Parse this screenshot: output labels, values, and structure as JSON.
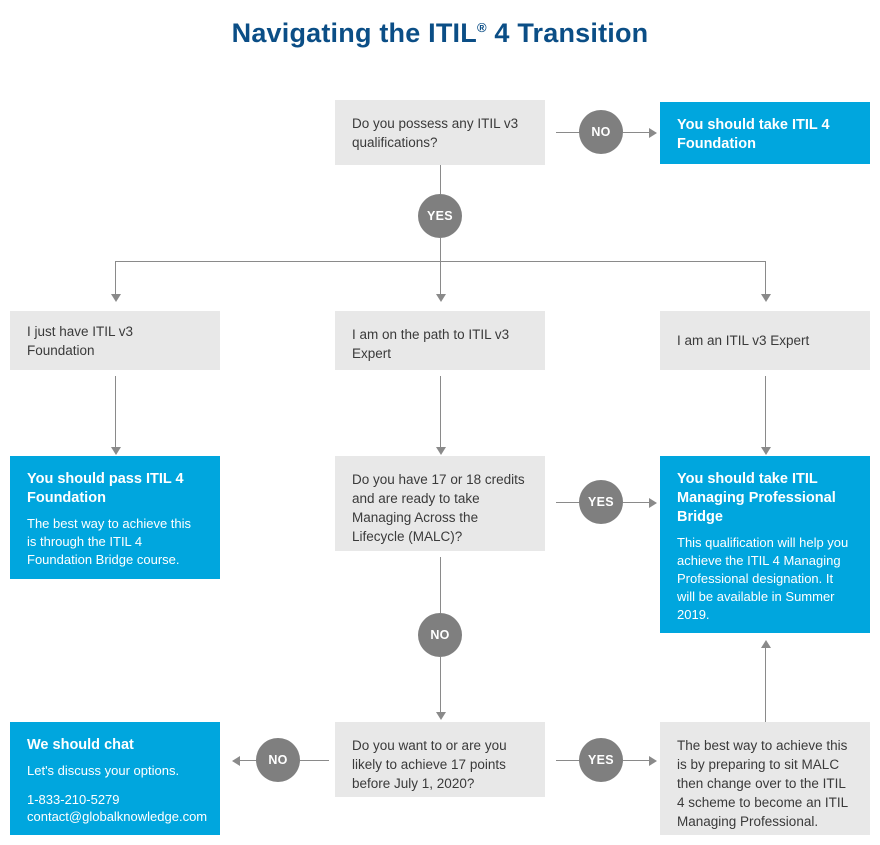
{
  "title": {
    "text_before": "Navigating the ITIL",
    "registered_mark": "®",
    "text_after": " 4 Transition"
  },
  "colors": {
    "title_blue": "#0b4e86",
    "accent_blue": "#00a6de",
    "box_gray": "#e8e8e8",
    "badge_gray": "#7f7f7f",
    "connector_gray": "#8a8a8a",
    "text_dark": "#3a3a3a"
  },
  "nodes": {
    "q_possess_v3": {
      "type": "question",
      "text": "Do you possess any ITIL v3 qualifications?"
    },
    "r_take_foundation": {
      "type": "result",
      "heading": "You should take ITIL 4 Foundation"
    },
    "b_just_foundation": {
      "type": "branch",
      "text": "I just have ITIL v3 Foundation"
    },
    "b_path_to_expert": {
      "type": "branch",
      "text": "I am on the path to ITIL v3 Expert"
    },
    "b_v3_expert": {
      "type": "branch",
      "text": "I am an ITIL v3 Expert"
    },
    "r_pass_foundation": {
      "type": "result",
      "heading": "You should pass ITIL 4 Foundation",
      "body": "The best way to achieve this is through the ITIL 4 Foundation Bridge course."
    },
    "q_credits_malc": {
      "type": "question",
      "text": "Do you have 17 or 18 credits and are ready to take Managing Across the Lifecycle (MALC)?"
    },
    "r_mp_bridge": {
      "type": "result",
      "heading": "You should take ITIL Managing Professional Bridge",
      "body": "This qualification will help you achieve the ITIL 4 Managing Professional designation. It will be available in Summer 2019."
    },
    "r_we_should_chat": {
      "type": "result",
      "heading": "We should chat",
      "body": "Let's discuss your options.",
      "phone": "1-833-210-5279",
      "email": "contact@globalknowledge.com"
    },
    "q_17_points": {
      "type": "question",
      "text": "Do you want to or are you likely to achieve 17 points before July 1, 2020?"
    },
    "r_prepare_malc": {
      "type": "info",
      "text": "The best way to achieve this is by preparing to sit MALC then change over to the ITIL 4 scheme to  become an ITIL Managing Professional."
    }
  },
  "badges": {
    "no_top": "NO",
    "yes_top": "YES",
    "yes_malc": "YES",
    "no_malc": "NO",
    "no_points": "NO",
    "yes_points": "YES"
  }
}
